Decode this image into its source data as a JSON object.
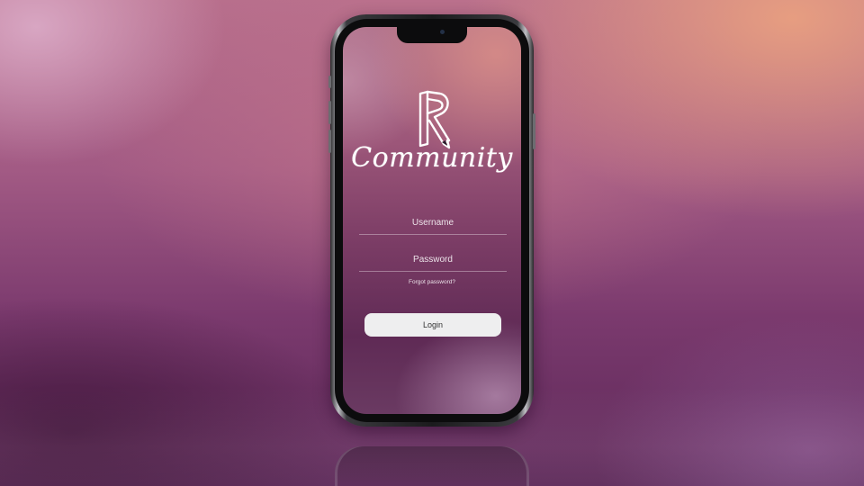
{
  "app": {
    "brand_name": "Community",
    "logo_icon": "r-monogram-icon"
  },
  "login_form": {
    "username_placeholder": "Username",
    "password_placeholder": "Password",
    "forgot_password_label": "Forgot password?",
    "login_button_label": "Login"
  },
  "colors": {
    "button_background": "#eeeeef",
    "button_text": "#333333",
    "text": "#ffffff"
  }
}
